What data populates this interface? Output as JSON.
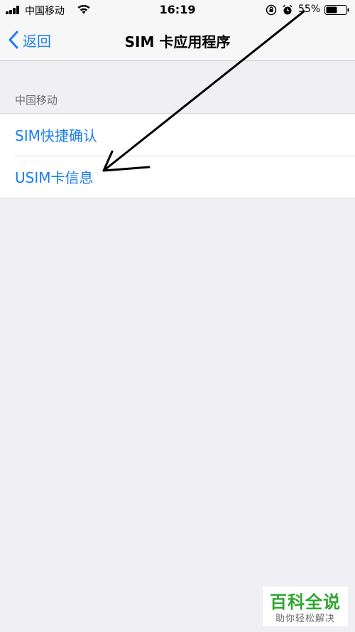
{
  "status_bar": {
    "carrier": "中国移动",
    "time": "16:19",
    "battery": "55%"
  },
  "nav": {
    "back_label": "返回",
    "title": "SIM 卡应用程序"
  },
  "section": {
    "header": "中国移动",
    "items": [
      {
        "label": "SIM快捷确认"
      },
      {
        "label": "USIM卡信息"
      }
    ]
  },
  "watermark": {
    "title": "百科全说",
    "subtitle": "助你轻松解决"
  },
  "colors": {
    "accent": "#1a7cf5",
    "background": "#efeff4",
    "watermark_green": "#2fa52f"
  },
  "icons": [
    "signal-icon",
    "wifi-icon",
    "lock-rotation-icon",
    "alarm-icon",
    "battery-icon",
    "back-chevron-icon"
  ]
}
